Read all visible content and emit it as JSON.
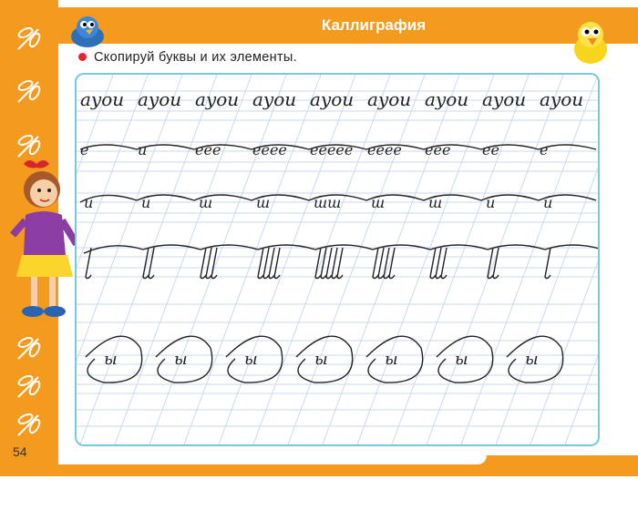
{
  "header": {
    "title": "Каллиграфия"
  },
  "instruction": {
    "text": "Скопируй буквы и их элементы."
  },
  "page": {
    "number": "54"
  },
  "rows": {
    "row1": {
      "word": "ayou",
      "count": 9
    },
    "row2": {
      "groups": [
        "е",
        "и",
        "eee",
        "eeee",
        "eeeee",
        "eeee",
        "eee",
        "ее",
        "е"
      ]
    },
    "row3": {
      "groups": [
        "и",
        "и",
        "ш",
        "ш",
        "шш",
        "ш",
        "ш",
        "и",
        "и"
      ]
    },
    "row4": {
      "groups": [
        "",
        "",
        "",
        "",
        "",
        "",
        "",
        "",
        ""
      ]
    },
    "row5": {
      "letter": "ы",
      "count": 7
    }
  },
  "colors": {
    "accent_orange": "#f49a1f",
    "frame_blue": "#79c8e0",
    "guide_line": "#c9d9ef",
    "bullet_red": "#e3262b"
  },
  "icons": [
    "dragonfly-icon",
    "blue-bird-icon",
    "yellow-bird-icon",
    "girl-illustration"
  ]
}
